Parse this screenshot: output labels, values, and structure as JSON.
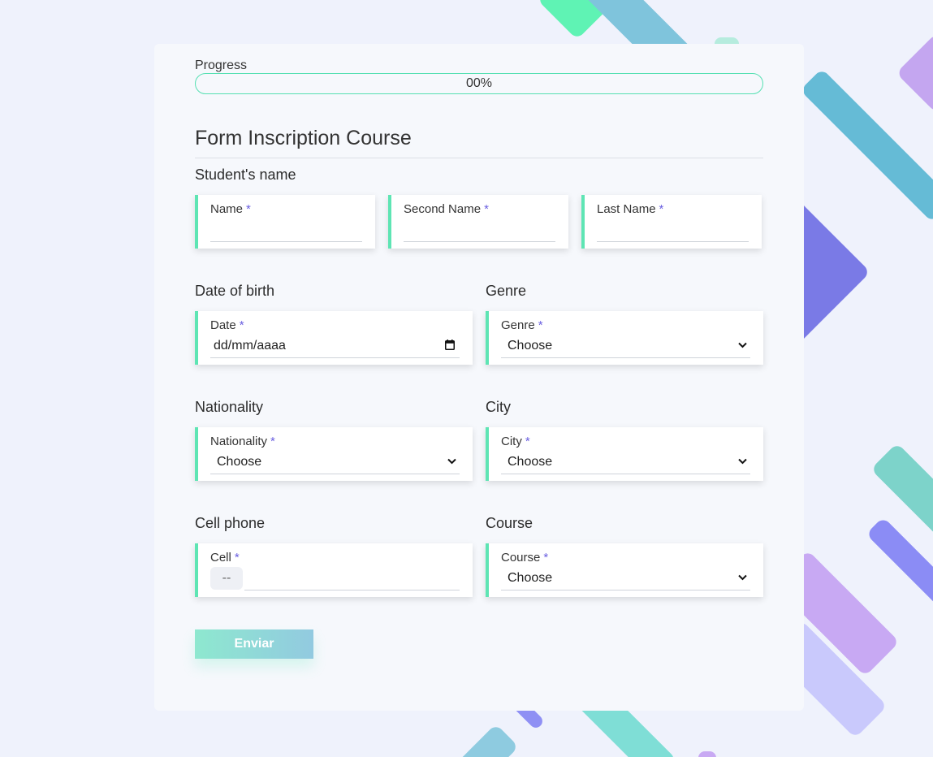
{
  "progress": {
    "label": "Progress",
    "value_text": "00%",
    "value": 0
  },
  "form": {
    "title": "Form Inscription Course",
    "required_marker": "*",
    "sections": {
      "student_name": "Student's name",
      "date_of_birth": "Date of birth",
      "genre": "Genre",
      "nationality": "Nationality",
      "city": "City",
      "cell_phone": "Cell phone",
      "course": "Course"
    },
    "fields": {
      "name": {
        "label": "Name",
        "value": ""
      },
      "second_name": {
        "label": "Second Name",
        "value": ""
      },
      "last_name": {
        "label": "Last Name",
        "value": ""
      },
      "date": {
        "label": "Date",
        "value": "dd/mm/aaaa",
        "icon": "calendar-icon"
      },
      "genre": {
        "label": "Genre",
        "selected": "Choose",
        "icon": "chevron-down-icon"
      },
      "nationality": {
        "label": "Nationality",
        "selected": "Choose",
        "icon": "chevron-down-icon"
      },
      "city": {
        "label": "City",
        "selected": "Choose",
        "icon": "chevron-down-icon"
      },
      "cell": {
        "label": "Cell",
        "prefix": "--",
        "value": ""
      },
      "course": {
        "label": "Course",
        "selected": "Choose",
        "icon": "chevron-down-icon"
      }
    },
    "submit_label": "Enviar"
  },
  "colors": {
    "page_bg": "#eff2fc",
    "card_bg": "#f6f8fc",
    "accent": "#5ee5b4",
    "required": "#6a5fe0",
    "decor_teal": "#6bb8d6",
    "decor_purple": "#7a7ae6",
    "decor_lilac": "#c7a8f2",
    "decor_mint": "#7dd8c9"
  }
}
